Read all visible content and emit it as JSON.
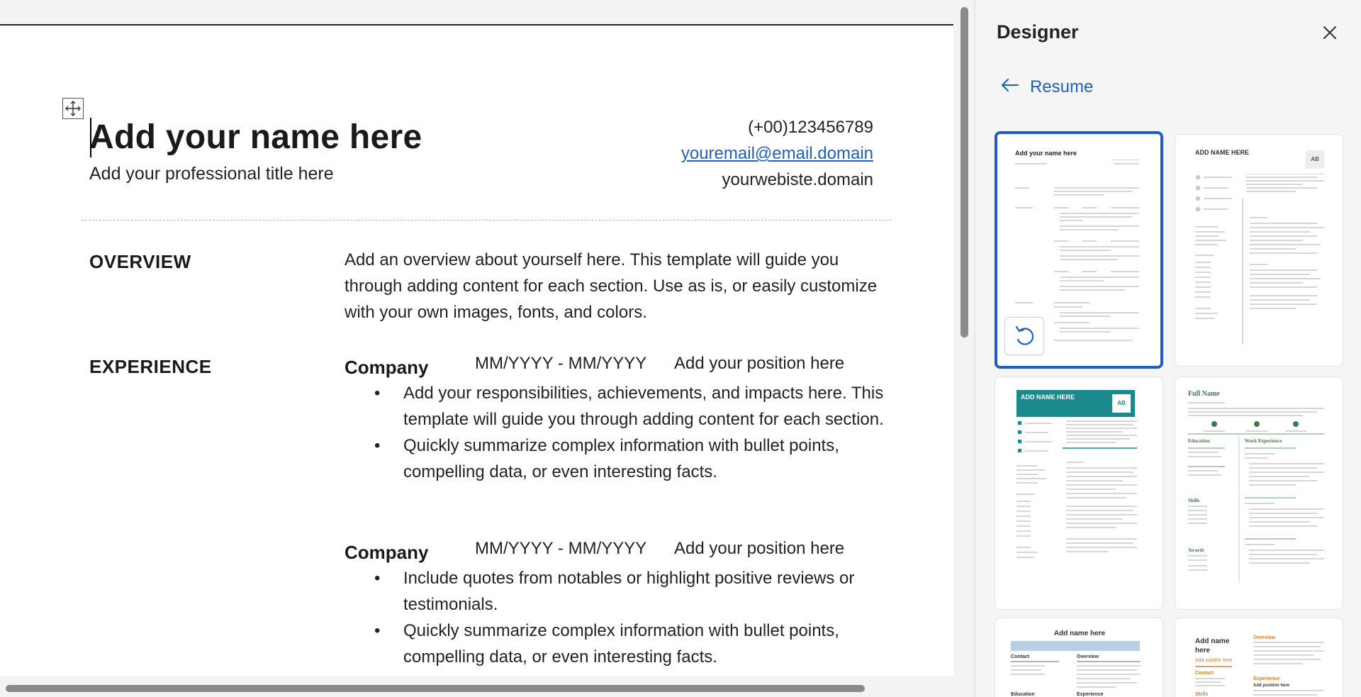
{
  "document": {
    "name": "Add your name here",
    "professional_title": "Add your professional title here",
    "phone": "(+00)123456789",
    "email": "youremail@email.domain",
    "website": "yourwebiste.domain",
    "overview_heading": "OVERVIEW",
    "overview_text": "Add an overview about yourself here. This template will guide you through adding content for each section. Use as is, or easily customize with your own images, fonts, and colors.",
    "experience_heading": "EXPERIENCE",
    "jobs": [
      {
        "company": "Company",
        "dates": "MM/YYYY - MM/YYYY",
        "position": "Add your position here",
        "bullets": [
          "Add your responsibilities, achievements, and impacts here. This template will guide you through adding content for each section.",
          "Quickly summarize complex information with bullet points, compelling data, or even interesting facts."
        ]
      },
      {
        "company": "Company",
        "dates": "MM/YYYY - MM/YYYY",
        "position": "Add your position here",
        "bullets": [
          "Include quotes from notables or highlight positive reviews or testimonials.",
          "Quickly summarize complex information with bullet points, compelling data, or even interesting facts."
        ]
      }
    ]
  },
  "designer": {
    "title": "Designer",
    "back_label": "Resume",
    "close_icon": "close-icon",
    "back_icon": "arrow-left-icon",
    "undo_icon": "undo-icon",
    "accent": "#1f5fbf",
    "teal": "#1a8a8f",
    "green": "#3a7d44",
    "orange": "#d9822b",
    "templates": {
      "t1": {
        "name": "Add your name here"
      },
      "t2": {
        "name": "ADD NAME HERE",
        "initials": "AB"
      },
      "t3": {
        "name": "ADD NAME HERE",
        "initials": "AB"
      },
      "t4": {
        "name": "Full Name",
        "col1": "Education",
        "col2": "Work Experience",
        "skills": "Skills",
        "awards": "Awards"
      },
      "t5": {
        "name": "Add name here",
        "contact": "Contact",
        "overview": "Overview",
        "education": "Education",
        "experience": "Experience"
      },
      "t6": {
        "name": "Add name here",
        "subtitle": "Add subtitle here",
        "overview": "Overview",
        "contact": "Contact",
        "experience": "Experience",
        "skills": "Skills",
        "position": "Add position here"
      }
    }
  }
}
